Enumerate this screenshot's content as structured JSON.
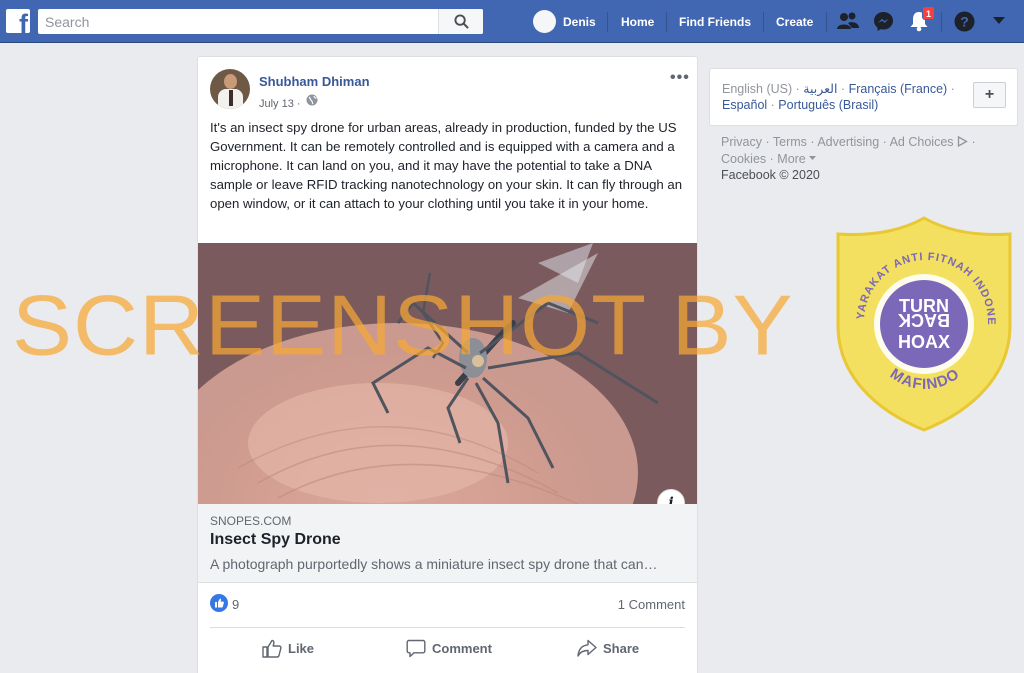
{
  "topbar": {
    "logo": "f",
    "search_placeholder": "Search",
    "user_name": "Denis",
    "nav": [
      "Home",
      "Find Friends",
      "Create"
    ],
    "notification_count": "1",
    "icons": [
      "friend-requests-icon",
      "messenger-icon",
      "notifications-icon",
      "help-icon",
      "account-menu-icon"
    ],
    "colors": {
      "bar": "#4267b2",
      "badge": "#fa3e3e"
    }
  },
  "post": {
    "author": "Shubham Dhiman",
    "date": "July 13 ·",
    "more": "•••",
    "text": "It's an insect spy drone for urban areas, already in production, funded by the US Government. It can be remotely controlled and is equipped with a camera and a microphone. It can land on you, and it may have the potential to take a DNA sample or leave RFID tracking nanotechnology on your skin. It can fly through an open window, or it can attach to your clothing until you take it in your home.",
    "link": {
      "domain": "SNOPES.COM",
      "title": "Insect Spy Drone",
      "description": "A photograph purportedly shows a miniature insect spy drone that can…",
      "info": "i"
    },
    "reactions": {
      "likes": "9",
      "comments": "1 Comment"
    },
    "actions": {
      "like": "Like",
      "comment": "Comment",
      "share": "Share"
    }
  },
  "sidebar": {
    "languages_line1": {
      "current": "English (US)",
      "arabic": "العربية",
      "french": "Français (France)"
    },
    "languages_line2": {
      "spanish": "Español",
      "portuguese": "Português (Brasil)"
    },
    "add_language": "+",
    "footer_line1": [
      "Privacy",
      "Terms",
      "Advertising",
      "Ad Choices"
    ],
    "footer_line2": [
      "Cookies",
      "More"
    ],
    "copyright": "Facebook © 2020"
  },
  "overlay": {
    "watermark": "SCREENSHOT BY",
    "badge_top": "MASYARAKAT ANTI FITNAH INDONESIA",
    "badge_bottom": "MAFINDO",
    "badge_center": [
      "TURN",
      "BACK",
      "HOAX"
    ]
  }
}
